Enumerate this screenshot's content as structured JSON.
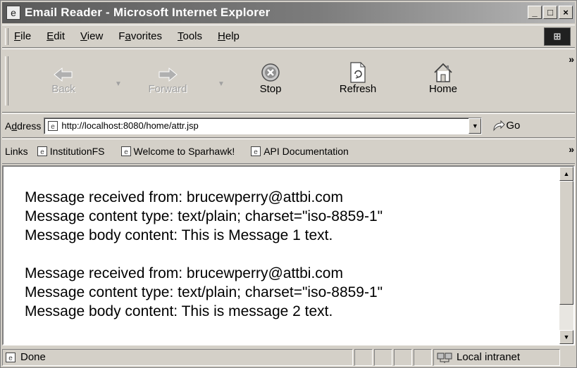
{
  "window": {
    "title": "Email Reader - Microsoft Internet Explorer",
    "controls": [
      "_",
      "□",
      "×"
    ]
  },
  "menu": [
    {
      "label": "File",
      "accel": "F",
      "rest": "ile"
    },
    {
      "label": "Edit",
      "accel": "E",
      "rest": "dit"
    },
    {
      "label": "View",
      "accel": "V",
      "rest": "iew"
    },
    {
      "label": "Favorites",
      "pre": "F",
      "accel": "a",
      "rest": "vorites"
    },
    {
      "label": "Tools",
      "accel": "T",
      "rest": "ools"
    },
    {
      "label": "Help",
      "accel": "H",
      "rest": "elp"
    }
  ],
  "toolbar": {
    "back": "Back",
    "forward": "Forward",
    "stop": "Stop",
    "refresh": "Refresh",
    "home": "Home",
    "more": "»"
  },
  "address": {
    "label_pre": "A",
    "label_accel": "d",
    "label_rest": "dress",
    "url": "http://localhost:8080/home/attr.jsp",
    "go": "Go"
  },
  "links": {
    "label": "Links",
    "items": [
      "InstitutionFS",
      "Welcome to Sparhawk!",
      "API Documentation"
    ],
    "more": "»"
  },
  "messages": [
    {
      "from": "Message received from: brucewperry@attbi.com",
      "type": "Message content type: text/plain; charset=\"iso-8859-1\"",
      "body": "Message body content: This is Message 1 text."
    },
    {
      "from": "Message received from: brucewperry@attbi.com",
      "type": "Message content type: text/plain; charset=\"iso-8859-1\"",
      "body": "Message body content: This is message 2 text."
    }
  ],
  "status": {
    "text": "Done",
    "zone": "Local intranet"
  },
  "icons": {
    "app": "ie-page-icon",
    "back": "back-arrow-icon",
    "forward": "forward-arrow-icon",
    "stop": "stop-icon",
    "refresh": "refresh-icon",
    "home": "home-icon",
    "go": "go-arrow-icon"
  }
}
